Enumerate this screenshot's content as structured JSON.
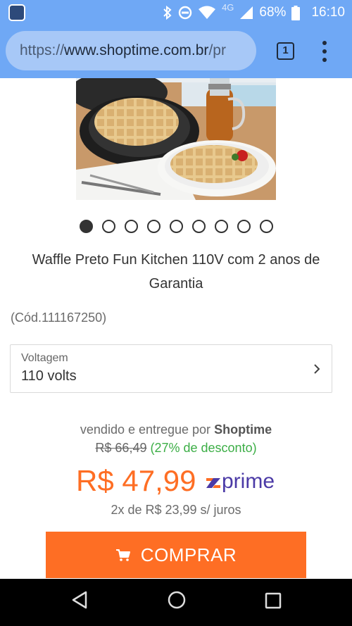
{
  "status_bar": {
    "network": "4G",
    "battery": "68%",
    "time": "16:10",
    "icons": [
      "app-icon",
      "bluetooth-icon",
      "do-not-disturb-icon",
      "wifi-icon",
      "signal-icon",
      "battery-icon"
    ]
  },
  "browser": {
    "url_scheme": "https://",
    "url_host": "www.shoptime.com.br",
    "url_path": "/pr",
    "tab_count": "1",
    "menu_icon": "more-vert-icon"
  },
  "product": {
    "carousel": {
      "total": 9,
      "active": 1
    },
    "title": "Waffle Preto Fun Kitchen 110V com 2 anos de Garantia",
    "code": "(Cód.111167250)",
    "voltage_label": "Voltagem",
    "voltage_value": "110 volts",
    "seller_prefix": "vendido e entregue por",
    "seller_name": "Shoptime",
    "old_price": "R$ 66,49",
    "discount": "(27% de desconto)",
    "price": "R$ 47,99",
    "prime_label": "prime",
    "installments": "2x de R$ 23,99 s/ juros",
    "buy_label": "COMPRAR"
  },
  "colors": {
    "accent": "#fe6e24",
    "discount": "#3cae46",
    "prime": "#4b3aa6",
    "chrome": "#6fa8f5"
  }
}
